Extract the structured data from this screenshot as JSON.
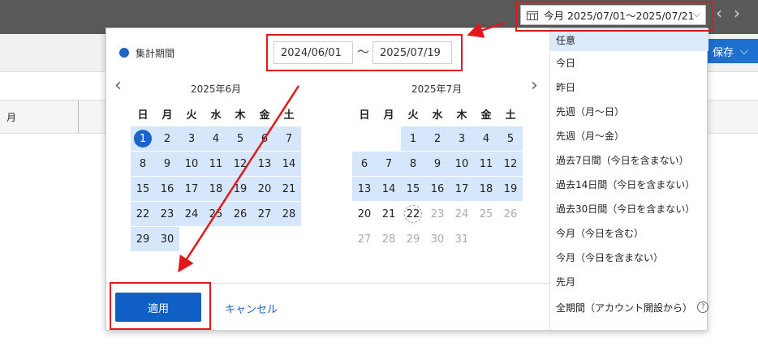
{
  "topbar": {
    "daterange_label": "今月 2025/07/01〜2025/07/21",
    "calendar_icon": "calendar-icon",
    "prev_icon": "chevron-left-icon",
    "next_icon": "chevron-right-icon"
  },
  "toolbar": {
    "save_label": "保存"
  },
  "grid": {
    "first_col": "月"
  },
  "popup": {
    "period_label": "集計期間",
    "start_date": "2024/06/01",
    "tilde": "〜",
    "end_date": "2025/07/19",
    "apply_label": "適用",
    "cancel_label": "キャンセル"
  },
  "calendars": [
    {
      "title": "2025年6月",
      "weekdays": [
        "日",
        "月",
        "火",
        "水",
        "木",
        "金",
        "土"
      ],
      "weeks": [
        [
          "1",
          "2",
          "3",
          "4",
          "5",
          "6",
          "7"
        ],
        [
          "8",
          "9",
          "10",
          "11",
          "12",
          "13",
          "14"
        ],
        [
          "15",
          "16",
          "17",
          "18",
          "19",
          "20",
          "21"
        ],
        [
          "22",
          "23",
          "24",
          "25",
          "26",
          "27",
          "28"
        ],
        [
          "29",
          "30",
          "",
          "",
          "",
          "",
          ""
        ]
      ]
    },
    {
      "title": "2025年7月",
      "weekdays": [
        "日",
        "月",
        "火",
        "水",
        "木",
        "金",
        "土"
      ],
      "weeks": [
        [
          "",
          "",
          "1",
          "2",
          "3",
          "4",
          "5"
        ],
        [
          "6",
          "7",
          "8",
          "9",
          "10",
          "11",
          "12"
        ],
        [
          "13",
          "14",
          "15",
          "16",
          "17",
          "18",
          "19"
        ],
        [
          "20",
          "21",
          "22",
          "23",
          "24",
          "25",
          "26"
        ],
        [
          "27",
          "28",
          "29",
          "30",
          "31",
          "",
          ""
        ]
      ]
    }
  ],
  "presets": [
    "任意",
    "今日",
    "昨日",
    "先週（月〜日）",
    "先週（月〜金）",
    "過去7日間（今日を含まない）",
    "過去14日間（今日を含まない）",
    "過去30日間（今日を含まない）",
    "今月（今日を含む）",
    "今月（今日を含まない）",
    "先月",
    "全期間（アカウント開設から）"
  ],
  "help_icon": "question-circle-icon",
  "colors": {
    "accent": "#1a64c8",
    "range": "#d6e6fb",
    "highlight": "#e0191a",
    "topbar": "#5a5a5a"
  }
}
